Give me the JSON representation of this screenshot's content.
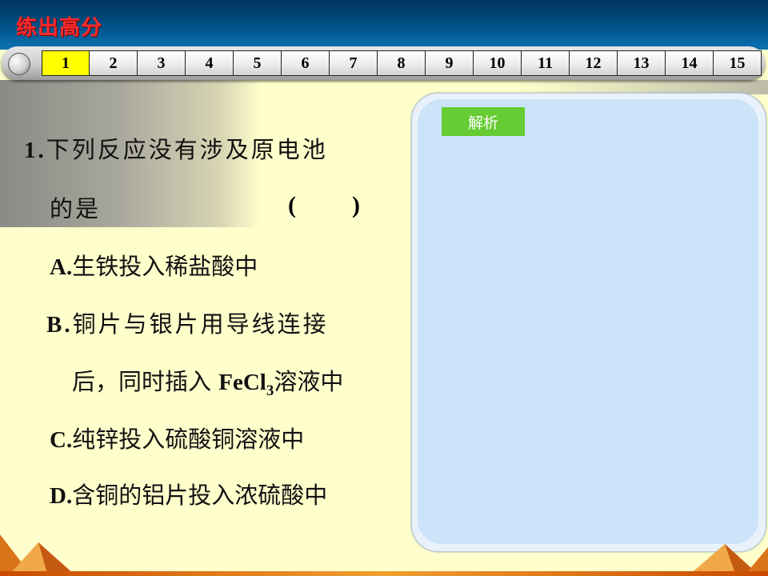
{
  "header": {
    "title": "练出高分"
  },
  "nav": {
    "items": [
      "1",
      "2",
      "3",
      "4",
      "5",
      "6",
      "7",
      "8",
      "9",
      "10",
      "11",
      "12",
      "13",
      "14",
      "15"
    ],
    "active_index": 0
  },
  "question": {
    "number": "1.",
    "stem_line1": "下列反应没有涉及原电池",
    "stem_line2": "的是",
    "paren_open": "(",
    "paren_close": ")",
    "option_a_label": "A.",
    "option_a_text": "生铁投入稀盐酸中",
    "option_b_label": "B.",
    "option_b_text": "铜片与银片用导线连接",
    "option_b_text2_pre": "后，同时插入",
    "option_b_formula": "FeCl",
    "option_b_formula_sub": "3",
    "option_b_text2_post": "溶液中",
    "option_c_label": "C.",
    "option_c_text": "纯锌投入硫酸铜溶液中",
    "option_d_label": "D.",
    "option_d_text": "含铜的铝片投入浓硫酸中"
  },
  "analysis": {
    "tag_label": "解析"
  },
  "colors": {
    "background": "#ffffcc",
    "header_title": "#ff2a2a",
    "nav_active": "#ffff00",
    "tag_bg": "#66cc33",
    "panel_bg": "#cce4fa"
  }
}
